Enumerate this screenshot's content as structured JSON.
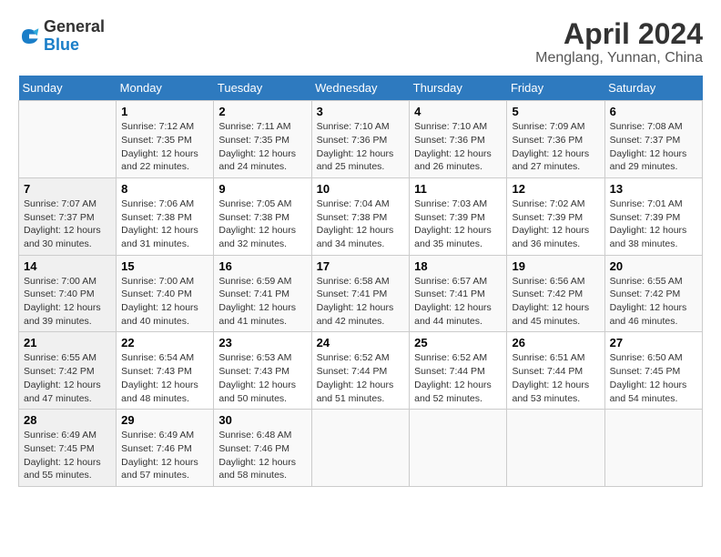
{
  "header": {
    "logo_general": "General",
    "logo_blue": "Blue",
    "month": "April 2024",
    "location": "Menglang, Yunnan, China"
  },
  "weekdays": [
    "Sunday",
    "Monday",
    "Tuesday",
    "Wednesday",
    "Thursday",
    "Friday",
    "Saturday"
  ],
  "weeks": [
    [
      {
        "day": "",
        "detail": ""
      },
      {
        "day": "1",
        "detail": "Sunrise: 7:12 AM\nSunset: 7:35 PM\nDaylight: 12 hours\nand 22 minutes."
      },
      {
        "day": "2",
        "detail": "Sunrise: 7:11 AM\nSunset: 7:35 PM\nDaylight: 12 hours\nand 24 minutes."
      },
      {
        "day": "3",
        "detail": "Sunrise: 7:10 AM\nSunset: 7:36 PM\nDaylight: 12 hours\nand 25 minutes."
      },
      {
        "day": "4",
        "detail": "Sunrise: 7:10 AM\nSunset: 7:36 PM\nDaylight: 12 hours\nand 26 minutes."
      },
      {
        "day": "5",
        "detail": "Sunrise: 7:09 AM\nSunset: 7:36 PM\nDaylight: 12 hours\nand 27 minutes."
      },
      {
        "day": "6",
        "detail": "Sunrise: 7:08 AM\nSunset: 7:37 PM\nDaylight: 12 hours\nand 29 minutes."
      }
    ],
    [
      {
        "day": "7",
        "detail": "Sunrise: 7:07 AM\nSunset: 7:37 PM\nDaylight: 12 hours\nand 30 minutes."
      },
      {
        "day": "8",
        "detail": "Sunrise: 7:06 AM\nSunset: 7:38 PM\nDaylight: 12 hours\nand 31 minutes."
      },
      {
        "day": "9",
        "detail": "Sunrise: 7:05 AM\nSunset: 7:38 PM\nDaylight: 12 hours\nand 32 minutes."
      },
      {
        "day": "10",
        "detail": "Sunrise: 7:04 AM\nSunset: 7:38 PM\nDaylight: 12 hours\nand 34 minutes."
      },
      {
        "day": "11",
        "detail": "Sunrise: 7:03 AM\nSunset: 7:39 PM\nDaylight: 12 hours\nand 35 minutes."
      },
      {
        "day": "12",
        "detail": "Sunrise: 7:02 AM\nSunset: 7:39 PM\nDaylight: 12 hours\nand 36 minutes."
      },
      {
        "day": "13",
        "detail": "Sunrise: 7:01 AM\nSunset: 7:39 PM\nDaylight: 12 hours\nand 38 minutes."
      }
    ],
    [
      {
        "day": "14",
        "detail": "Sunrise: 7:00 AM\nSunset: 7:40 PM\nDaylight: 12 hours\nand 39 minutes."
      },
      {
        "day": "15",
        "detail": "Sunrise: 7:00 AM\nSunset: 7:40 PM\nDaylight: 12 hours\nand 40 minutes."
      },
      {
        "day": "16",
        "detail": "Sunrise: 6:59 AM\nSunset: 7:41 PM\nDaylight: 12 hours\nand 41 minutes."
      },
      {
        "day": "17",
        "detail": "Sunrise: 6:58 AM\nSunset: 7:41 PM\nDaylight: 12 hours\nand 42 minutes."
      },
      {
        "day": "18",
        "detail": "Sunrise: 6:57 AM\nSunset: 7:41 PM\nDaylight: 12 hours\nand 44 minutes."
      },
      {
        "day": "19",
        "detail": "Sunrise: 6:56 AM\nSunset: 7:42 PM\nDaylight: 12 hours\nand 45 minutes."
      },
      {
        "day": "20",
        "detail": "Sunrise: 6:55 AM\nSunset: 7:42 PM\nDaylight: 12 hours\nand 46 minutes."
      }
    ],
    [
      {
        "day": "21",
        "detail": "Sunrise: 6:55 AM\nSunset: 7:42 PM\nDaylight: 12 hours\nand 47 minutes."
      },
      {
        "day": "22",
        "detail": "Sunrise: 6:54 AM\nSunset: 7:43 PM\nDaylight: 12 hours\nand 48 minutes."
      },
      {
        "day": "23",
        "detail": "Sunrise: 6:53 AM\nSunset: 7:43 PM\nDaylight: 12 hours\nand 50 minutes."
      },
      {
        "day": "24",
        "detail": "Sunrise: 6:52 AM\nSunset: 7:44 PM\nDaylight: 12 hours\nand 51 minutes."
      },
      {
        "day": "25",
        "detail": "Sunrise: 6:52 AM\nSunset: 7:44 PM\nDaylight: 12 hours\nand 52 minutes."
      },
      {
        "day": "26",
        "detail": "Sunrise: 6:51 AM\nSunset: 7:44 PM\nDaylight: 12 hours\nand 53 minutes."
      },
      {
        "day": "27",
        "detail": "Sunrise: 6:50 AM\nSunset: 7:45 PM\nDaylight: 12 hours\nand 54 minutes."
      }
    ],
    [
      {
        "day": "28",
        "detail": "Sunrise: 6:49 AM\nSunset: 7:45 PM\nDaylight: 12 hours\nand 55 minutes."
      },
      {
        "day": "29",
        "detail": "Sunrise: 6:49 AM\nSunset: 7:46 PM\nDaylight: 12 hours\nand 57 minutes."
      },
      {
        "day": "30",
        "detail": "Sunrise: 6:48 AM\nSunset: 7:46 PM\nDaylight: 12 hours\nand 58 minutes."
      },
      {
        "day": "",
        "detail": ""
      },
      {
        "day": "",
        "detail": ""
      },
      {
        "day": "",
        "detail": ""
      },
      {
        "day": "",
        "detail": ""
      }
    ]
  ]
}
